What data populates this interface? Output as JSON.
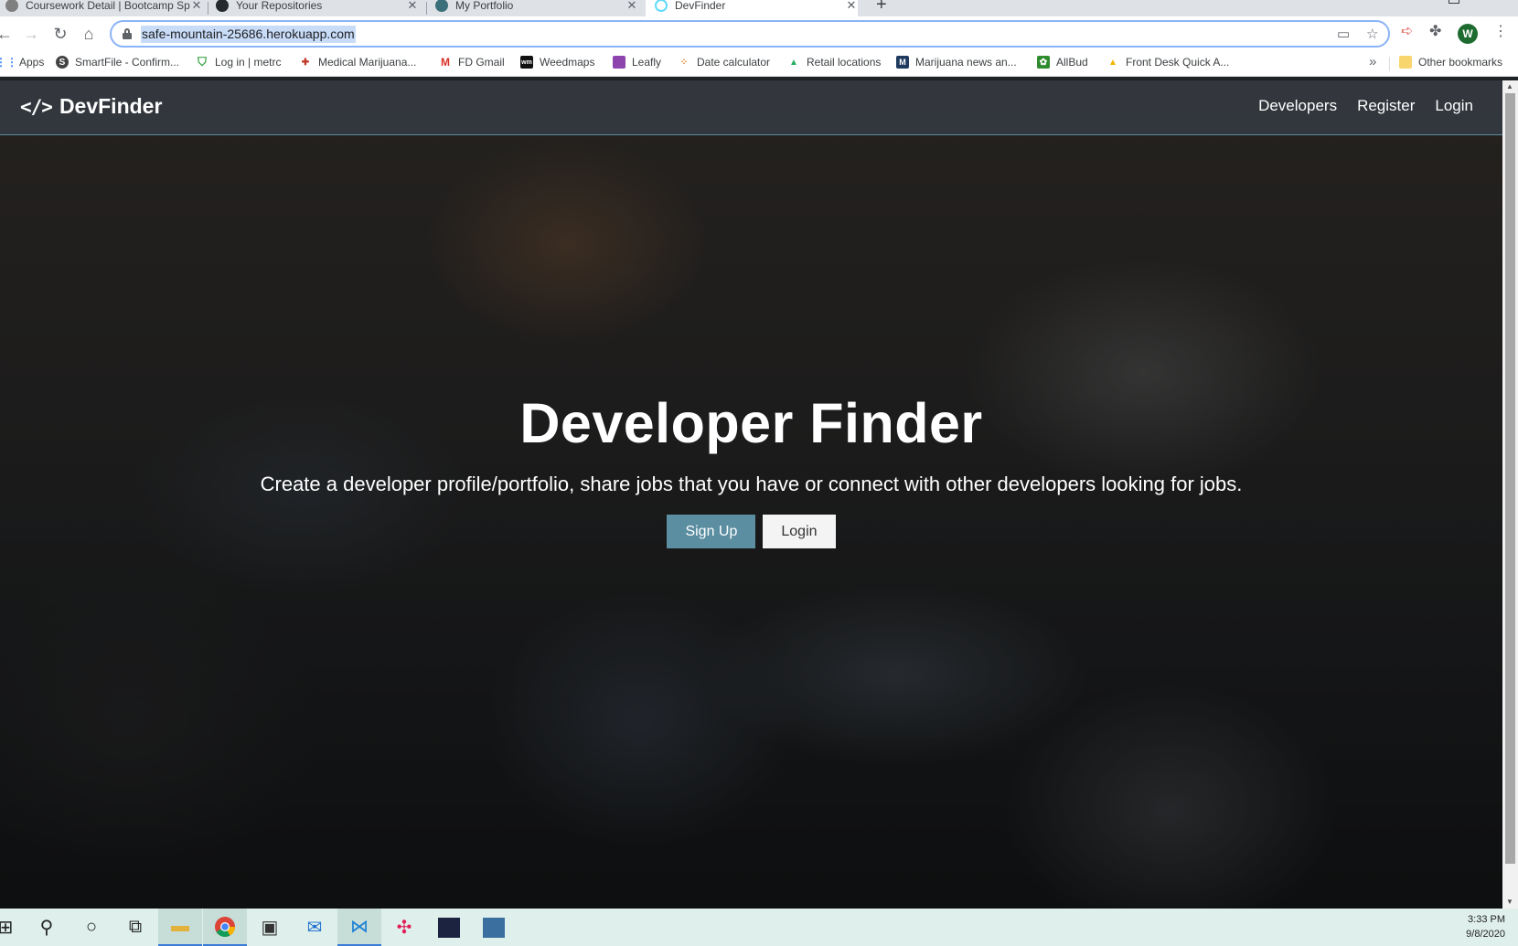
{
  "browser": {
    "tabs": [
      {
        "title": "Coursework Detail | Bootcamp Sp",
        "icon_color": "#7f7f7f",
        "active": false
      },
      {
        "title": "Your Repositories",
        "icon_color": "#24292e",
        "active": false
      },
      {
        "title": "My Portfolio",
        "icon_color": "#3b6f7a",
        "active": false
      },
      {
        "title": "DevFinder",
        "icon_color": "#61dafb",
        "active": true
      }
    ],
    "new_tab_icon": "plus-icon",
    "url": "safe-mountain-25686.herokuapp.com",
    "profile_initial": "W",
    "bookmarks": [
      {
        "label": "Apps",
        "icon": "apps-grid-icon",
        "color": "#4285f4"
      },
      {
        "label": "SmartFile - Confirm...",
        "icon": "smartfile-icon",
        "color": "#444444"
      },
      {
        "label": "Log in | metrc",
        "icon": "metrc-shield-icon",
        "color": "#2e9e3a"
      },
      {
        "label": "Medical Marijuana...",
        "icon": "medical-icon",
        "color": "#c0392b"
      },
      {
        "label": "FD Gmail",
        "icon": "gmail-icon",
        "color": "#d93025"
      },
      {
        "label": "Weedmaps",
        "icon": "weedmaps-icon",
        "color": "#111111"
      },
      {
        "label": "Leafly",
        "icon": "leafly-icon",
        "color": "#8e44ad"
      },
      {
        "label": "Date calculator",
        "icon": "date-calculator-icon",
        "color": "#e67e22"
      },
      {
        "label": "Retail locations",
        "icon": "retail-icon",
        "color": "#27ae60"
      },
      {
        "label": "Marijuana news an...",
        "icon": "news-icon",
        "color": "#1f3a5f"
      },
      {
        "label": "AllBud",
        "icon": "allbud-icon",
        "color": "#2e8b2e"
      },
      {
        "label": "Front Desk Quick A...",
        "icon": "drive-icon",
        "color": "#f4b400"
      }
    ],
    "other_bookmarks": "Other bookmarks"
  },
  "site": {
    "brand": "DevFinder",
    "brand_icon": "</>",
    "nav": [
      "Developers",
      "Register",
      "Login"
    ],
    "hero_title": "Developer Finder",
    "hero_subtitle": "Create a developer profile/portfolio, share jobs that you have or connect with other developers looking for jobs.",
    "signup_label": "Sign Up",
    "login_label": "Login",
    "accent_color": "#5b8ea1"
  },
  "taskbar": {
    "time": "3:33 PM",
    "date": "9/8/2020",
    "apps": [
      "windows-start-icon",
      "search-icon",
      "cortana-icon",
      "task-view-icon",
      "file-explorer-icon",
      "chrome-icon",
      "store-icon",
      "mail-icon",
      "vscode-icon",
      "slack-icon",
      "terminal-app-icon",
      "mysql-workbench-icon"
    ]
  }
}
